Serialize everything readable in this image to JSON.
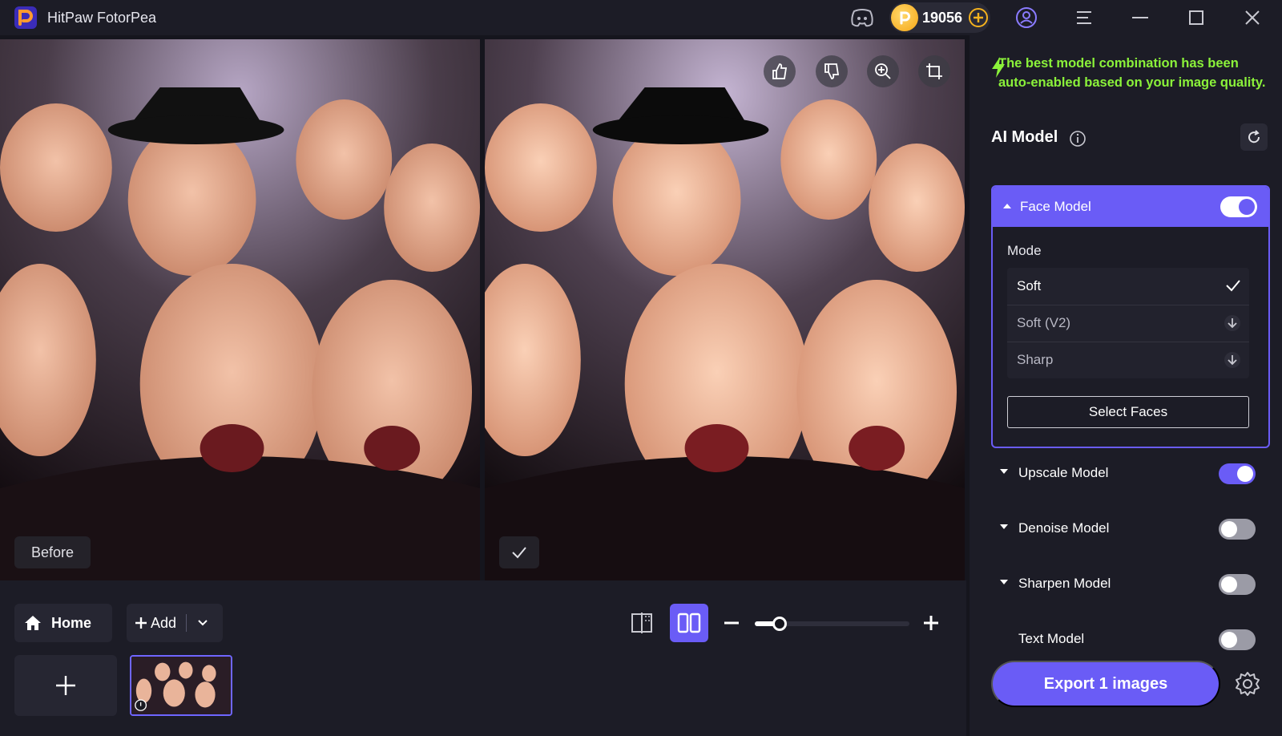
{
  "app": {
    "title": "HitPaw FotorPea",
    "coins": "19056"
  },
  "photos": {
    "before_label": "Before"
  },
  "bottom": {
    "home_label": "Home",
    "add_label": "Add",
    "zoom_level": 0.16
  },
  "panel": {
    "notice": "The best model combination has been auto-enabled based on your image quality.",
    "ai_model_title": "AI Model",
    "face_model": {
      "label": "Face Model",
      "enabled": true,
      "mode_label": "Mode",
      "modes": [
        {
          "label": "Soft",
          "state": "selected"
        },
        {
          "label": "Soft (V2)",
          "state": "download"
        },
        {
          "label": "Sharp",
          "state": "download"
        }
      ],
      "select_faces_label": "Select Faces"
    },
    "models": [
      {
        "label": "Upscale Model",
        "enabled": true
      },
      {
        "label": "Denoise Model",
        "enabled": false
      },
      {
        "label": "Sharpen Model",
        "enabled": false
      },
      {
        "label": "Text Model",
        "enabled": false
      }
    ],
    "export_label": "Export 1 images"
  },
  "colors": {
    "accent": "#6a5cf6",
    "notice": "#8bf23a",
    "panel_bg": "#1c1c26"
  },
  "icons": [
    "app-logo-icon",
    "discord-icon",
    "coin-icon",
    "coin-plus-icon",
    "user-icon",
    "menu-icon",
    "minimize-icon",
    "maximize-icon",
    "close-icon",
    "thumbs-up-icon",
    "thumbs-down-icon",
    "zoom-in-icon",
    "crop-icon",
    "home-icon",
    "plus-icon",
    "chevron-down-icon",
    "compare-single-icon",
    "compare-split-icon",
    "minus-icon",
    "lightning-icon",
    "info-icon",
    "refresh-icon",
    "check-icon",
    "download-icon",
    "caret-up-icon",
    "caret-down-icon",
    "gear-icon"
  ]
}
